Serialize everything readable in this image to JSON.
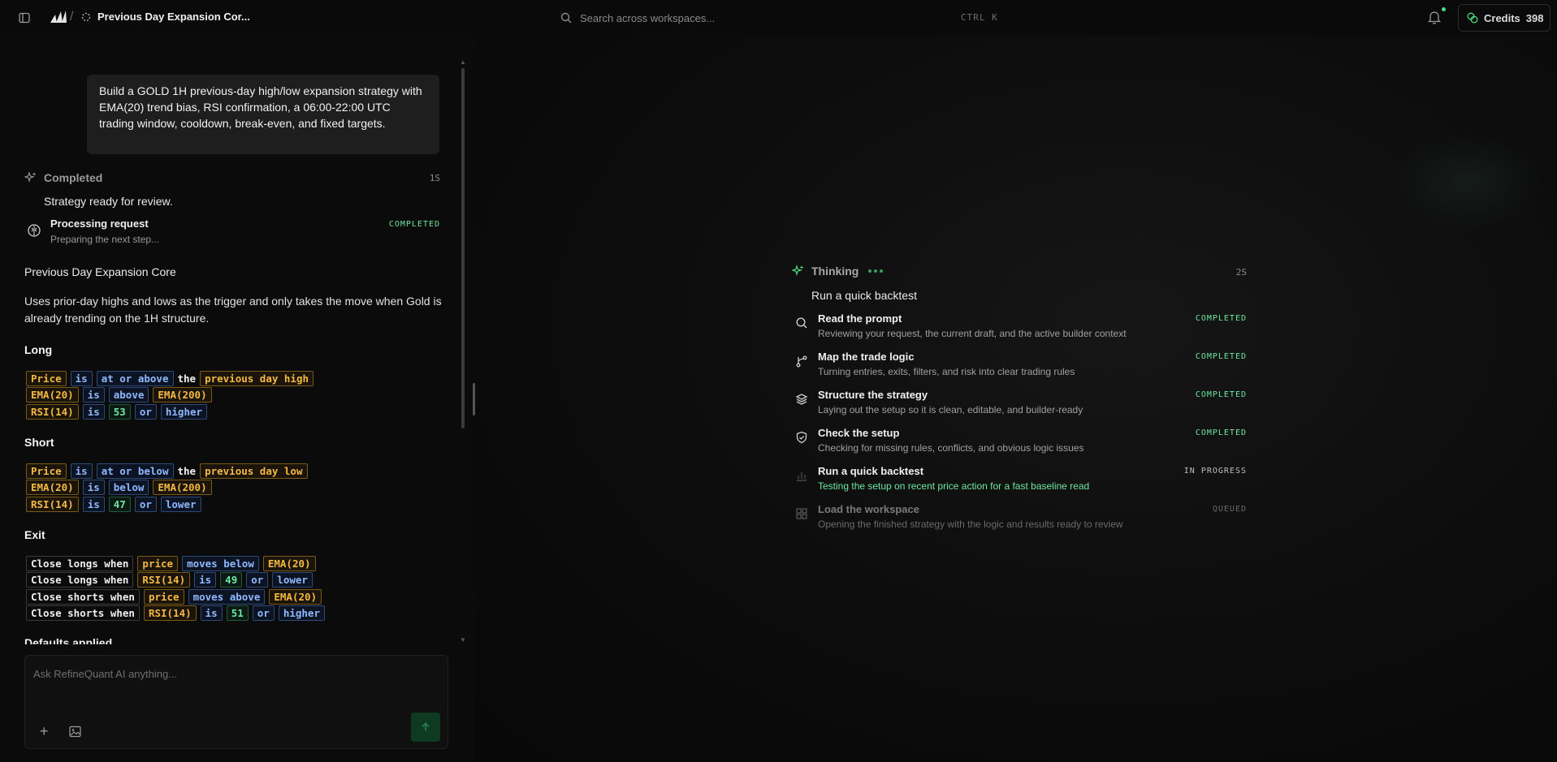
{
  "colors": {
    "background": "#0a0a0a",
    "accent_green": "#6ee7a0",
    "indicator_amber": "#f5b942",
    "operator_blue": "#8fb8ff"
  },
  "header": {
    "sidebar_icon": "sidebar-toggle-icon",
    "logo_icon": "refinequant-logo",
    "breadcrumb_separator": "/",
    "breadcrumb_title": "Previous Day Expansion Cor...",
    "search_placeholder": "Search across workspaces...",
    "search_shortcut": "CTRL K",
    "credits_label": "Credits",
    "credits_value": "398"
  },
  "chat": {
    "prompt": "Build a GOLD 1H previous-day high/low expansion strategy with EMA(20) trend bias, RSI confirmation, a 06:00-22:00 UTC trading window, cooldown, break-even, and fixed targets.",
    "status_label": "Completed",
    "status_time": "1S",
    "ready_text": "Strategy ready for review.",
    "process": {
      "title": "Processing request",
      "subtitle": "Preparing the next step...",
      "status": "COMPLETED"
    },
    "strategy_name": "Previous Day Expansion Core",
    "strategy_description": "Uses prior-day highs and lows as the trigger and only takes the move when Gold is already trending on the 1H structure.",
    "long_title": "Long",
    "long_rules": [
      [
        {
          "t": "ind",
          "v": "Price"
        },
        {
          "t": "op",
          "v": "is"
        },
        {
          "t": "op",
          "v": "at or above"
        },
        {
          "t": "plain",
          "v": "the"
        },
        {
          "t": "ind",
          "v": "previous day high"
        }
      ],
      [
        {
          "t": "ind",
          "v": "EMA(20)"
        },
        {
          "t": "op",
          "v": "is"
        },
        {
          "t": "op",
          "v": "above"
        },
        {
          "t": "ind",
          "v": "EMA(200)"
        }
      ],
      [
        {
          "t": "ind",
          "v": "RSI(14)"
        },
        {
          "t": "op",
          "v": "is"
        },
        {
          "t": "num",
          "v": "53"
        },
        {
          "t": "op",
          "v": "or"
        },
        {
          "t": "op",
          "v": "higher"
        }
      ]
    ],
    "short_title": "Short",
    "short_rules": [
      [
        {
          "t": "ind",
          "v": "Price"
        },
        {
          "t": "op",
          "v": "is"
        },
        {
          "t": "op",
          "v": "at or below"
        },
        {
          "t": "plain",
          "v": "the"
        },
        {
          "t": "ind",
          "v": "previous day low"
        }
      ],
      [
        {
          "t": "ind",
          "v": "EMA(20)"
        },
        {
          "t": "op",
          "v": "is"
        },
        {
          "t": "op",
          "v": "below"
        },
        {
          "t": "ind",
          "v": "EMA(200)"
        }
      ],
      [
        {
          "t": "ind",
          "v": "RSI(14)"
        },
        {
          "t": "op",
          "v": "is"
        },
        {
          "t": "num",
          "v": "47"
        },
        {
          "t": "op",
          "v": "or"
        },
        {
          "t": "op",
          "v": "lower"
        }
      ]
    ],
    "exit_title": "Exit",
    "exit_rules": [
      [
        {
          "t": "exit",
          "v": "Close longs when"
        },
        {
          "t": "ind",
          "v": "price"
        },
        {
          "t": "op",
          "v": "moves below"
        },
        {
          "t": "ind",
          "v": "EMA(20)"
        }
      ],
      [
        {
          "t": "exit",
          "v": "Close longs when"
        },
        {
          "t": "ind",
          "v": "RSI(14)"
        },
        {
          "t": "op",
          "v": "is"
        },
        {
          "t": "num",
          "v": "49"
        },
        {
          "t": "op",
          "v": "or"
        },
        {
          "t": "op",
          "v": "lower"
        }
      ],
      [
        {
          "t": "exit",
          "v": "Close shorts when"
        },
        {
          "t": "ind",
          "v": "price"
        },
        {
          "t": "op",
          "v": "moves above"
        },
        {
          "t": "ind",
          "v": "EMA(20)"
        }
      ],
      [
        {
          "t": "exit",
          "v": "Close shorts when"
        },
        {
          "t": "ind",
          "v": "RSI(14)"
        },
        {
          "t": "op",
          "v": "is"
        },
        {
          "t": "num",
          "v": "51"
        },
        {
          "t": "op",
          "v": "or"
        },
        {
          "t": "op",
          "v": "higher"
        }
      ]
    ],
    "defaults_title": "Defaults applied"
  },
  "composer": {
    "placeholder": "Ask RefineQuant AI anything..."
  },
  "thinking": {
    "label": "Thinking",
    "time": "2S",
    "current": "Run a quick backtest",
    "steps": [
      {
        "icon": "search-icon",
        "title": "Read the prompt",
        "subtitle": "Reviewing your request, the current draft, and the active builder context",
        "status": "COMPLETED",
        "state": "done"
      },
      {
        "icon": "branch-icon",
        "title": "Map the trade logic",
        "subtitle": "Turning entries, exits, filters, and risk into clear trading rules",
        "status": "COMPLETED",
        "state": "done"
      },
      {
        "icon": "layers-icon",
        "title": "Structure the strategy",
        "subtitle": "Laying out the setup so it is clean, editable, and builder-ready",
        "status": "COMPLETED",
        "state": "done"
      },
      {
        "icon": "shield-check-icon",
        "title": "Check the setup",
        "subtitle": "Checking for missing rules, conflicts, and obvious logic issues",
        "status": "COMPLETED",
        "state": "done"
      },
      {
        "icon": "bar-chart-icon",
        "title": "Run a quick backtest",
        "subtitle": "Testing the setup on recent price action for a fast baseline read",
        "status": "IN PROGRESS",
        "state": "progress"
      },
      {
        "icon": "grid-icon",
        "title": "Load the workspace",
        "subtitle": "Opening the finished strategy with the logic and results ready to review",
        "status": "QUEUED",
        "state": "queued"
      }
    ]
  }
}
